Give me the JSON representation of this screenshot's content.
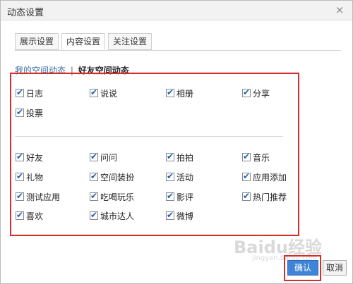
{
  "dialog": {
    "title": "动态设置",
    "close_symbol": "×"
  },
  "tabs": [
    {
      "label": "展示设置"
    },
    {
      "label": "内容设置"
    },
    {
      "label": "关注设置"
    }
  ],
  "subtabs": {
    "mine": "我的空间动态",
    "separator": "|",
    "friends": "好友空间动态"
  },
  "group1": [
    {
      "label": "日志",
      "checked": true
    },
    {
      "label": "说说",
      "checked": true
    },
    {
      "label": "相册",
      "checked": true
    },
    {
      "label": "分享",
      "checked": true
    },
    {
      "label": "投票",
      "checked": true
    }
  ],
  "group2": [
    {
      "label": "好友",
      "checked": true
    },
    {
      "label": "问问",
      "checked": true
    },
    {
      "label": "拍拍",
      "checked": true
    },
    {
      "label": "音乐",
      "checked": true
    },
    {
      "label": "礼物",
      "checked": true
    },
    {
      "label": "空间装扮",
      "checked": true
    },
    {
      "label": "活动",
      "checked": true
    },
    {
      "label": "应用添加",
      "checked": true
    },
    {
      "label": "测试应用",
      "checked": true
    },
    {
      "label": "吃喝玩乐",
      "checked": true
    },
    {
      "label": "影评",
      "checked": true
    },
    {
      "label": "热门推荐",
      "checked": true
    },
    {
      "label": "喜欢",
      "checked": true
    },
    {
      "label": "城市达人",
      "checked": true
    },
    {
      "label": "微博",
      "checked": true
    }
  ],
  "buttons": {
    "confirm": "确认",
    "cancel": "取消"
  },
  "watermark": {
    "brand": "Baidu经验",
    "url": "jingyan.baidu.com"
  },
  "colors": {
    "highlight": "#d62c2c",
    "primary": "#3f84d6",
    "link": "#3a6ea5"
  }
}
